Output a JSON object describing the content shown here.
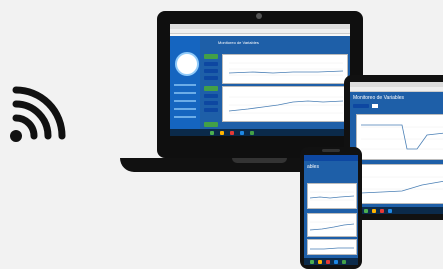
{
  "laptop": {
    "dashboard_title": "Monitoreo de Variables",
    "logo_icon": "circular-logo-icon"
  },
  "tablet": {
    "dashboard_title": "Monitoreo de Variables"
  },
  "phone": {
    "title": "ables"
  },
  "colors": {
    "dashboard_blue": "#1e5fa8",
    "accent_green": "#43a047",
    "device_black": "#111111"
  },
  "icons": [
    "wifi-icon",
    "laptop-icon",
    "tablet-icon",
    "phone-icon"
  ]
}
